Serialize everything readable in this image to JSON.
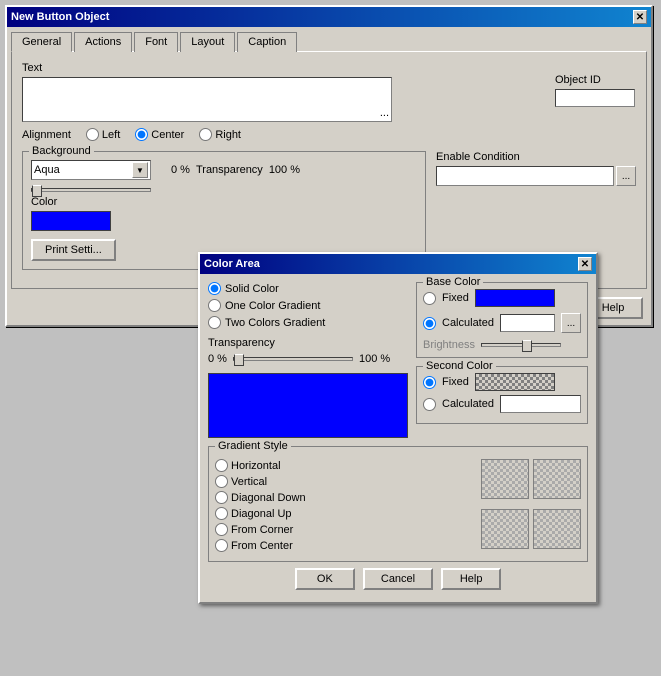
{
  "mainWindow": {
    "title": "New Button Object",
    "closeLabel": "✕",
    "tabs": [
      {
        "label": "General",
        "active": true
      },
      {
        "label": "Actions"
      },
      {
        "label": "Font"
      },
      {
        "label": "Layout"
      },
      {
        "label": "Caption"
      }
    ],
    "textSection": {
      "label": "Text"
    },
    "objectId": {
      "label": "Object ID"
    },
    "alignment": {
      "label": "Alignment",
      "options": [
        "Left",
        "Center",
        "Right"
      ],
      "selected": "Center"
    },
    "background": {
      "legend": "Background",
      "dropdownValue": "Aqua",
      "transparencyLabel": "Transparency",
      "transparencyLeft": "0 %",
      "transparencyRight": "100 %"
    },
    "color": {
      "label": "Color"
    },
    "enableCondition": {
      "label": "Enable Condition"
    },
    "printButton": "Print Setti..."
  },
  "colorArea": {
    "title": "Color Area",
    "closeLabel": "✕",
    "colorTypes": [
      {
        "label": "Solid Color",
        "selected": true
      },
      {
        "label": "One Color Gradient"
      },
      {
        "label": "Two Colors Gradient"
      }
    ],
    "baseColor": {
      "legend": "Base Color",
      "fixedLabel": "Fixed",
      "calculatedLabel": "Calculated",
      "selected": "Calculated",
      "dotsBtn": "..."
    },
    "transparency": {
      "label": "Transparency",
      "left": "0 %",
      "right": "100 %"
    },
    "brightness": {
      "label": "Brightness"
    },
    "secondColor": {
      "legend": "Second Color",
      "fixedLabel": "Fixed",
      "calculatedLabel": "Calculated",
      "dotsBtn": "..."
    },
    "gradientStyle": {
      "legend": "Gradient Style",
      "options": [
        {
          "label": "Horizontal"
        },
        {
          "label": "Vertical"
        },
        {
          "label": "Diagonal Down"
        },
        {
          "label": "Diagonal Up"
        },
        {
          "label": "From Corner"
        },
        {
          "label": "From Center"
        }
      ]
    },
    "buttons": {
      "ok": "OK",
      "cancel": "Cancel",
      "help": "Help"
    }
  },
  "mainButtons": {
    "help": "Help"
  }
}
